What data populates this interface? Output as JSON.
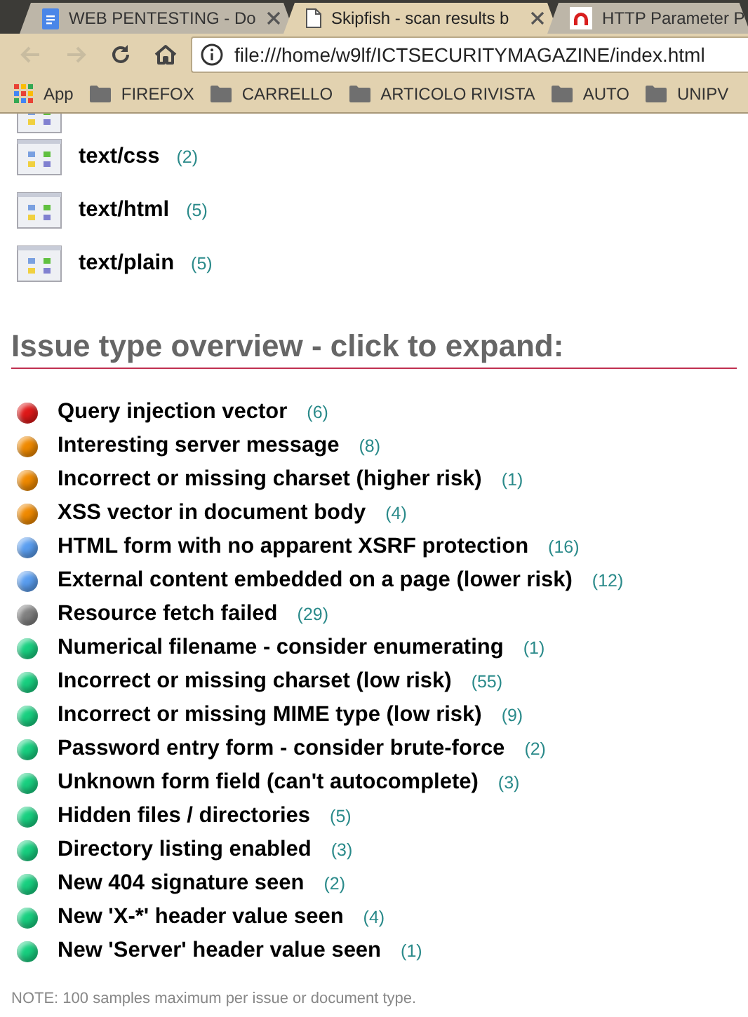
{
  "tabs": [
    {
      "title": "WEB PENTESTING - Do",
      "kind": "doc",
      "selected": false
    },
    {
      "title": "Skipfish - scan results b",
      "kind": "page",
      "selected": true
    },
    {
      "title": "HTTP Parameter P",
      "kind": "arc",
      "selected": false
    }
  ],
  "address_bar": {
    "url": "file:///home/w9lf/ICTSECURITYMAGAZINE/index.html"
  },
  "bookmarks": [
    {
      "label": "App",
      "kind": "apps"
    },
    {
      "label": "FIREFOX",
      "kind": "folder"
    },
    {
      "label": "CARRELLO",
      "kind": "folder"
    },
    {
      "label": "ARTICOLO RIVISTA",
      "kind": "folder"
    },
    {
      "label": "AUTO",
      "kind": "folder"
    },
    {
      "label": "UNIPV",
      "kind": "folder"
    }
  ],
  "document_types": [
    {
      "name": "text/css",
      "count": "(2)"
    },
    {
      "name": "text/html",
      "count": "(5)"
    },
    {
      "name": "text/plain",
      "count": "(5)"
    }
  ],
  "issue_overview": {
    "heading": "Issue type overview - click to expand:",
    "issues": [
      {
        "name": "Query injection vector",
        "count": "(6)",
        "color": "#e01818"
      },
      {
        "name": "Interesting server message",
        "count": "(8)",
        "color": "#f08a00"
      },
      {
        "name": "Incorrect or missing charset (higher risk)",
        "count": "(1)",
        "color": "#f08a00"
      },
      {
        "name": "XSS vector in document body",
        "count": "(4)",
        "color": "#f08a00"
      },
      {
        "name": "HTML form with no apparent XSRF protection",
        "count": "(16)",
        "color": "#5a9ef0"
      },
      {
        "name": "External content embedded on a page (lower risk)",
        "count": "(12)",
        "color": "#5a9ef0"
      },
      {
        "name": "Resource fetch failed",
        "count": "(29)",
        "color": "#808080"
      },
      {
        "name": "Numerical filename - consider enumerating",
        "count": "(1)",
        "color": "#18d080"
      },
      {
        "name": "Incorrect or missing charset (low risk)",
        "count": "(55)",
        "color": "#18d080"
      },
      {
        "name": "Incorrect or missing MIME type (low risk)",
        "count": "(9)",
        "color": "#18d080"
      },
      {
        "name": "Password entry form - consider brute-force",
        "count": "(2)",
        "color": "#18d080"
      },
      {
        "name": "Unknown form field (can't autocomplete)",
        "count": "(3)",
        "color": "#18d080"
      },
      {
        "name": "Hidden files / directories",
        "count": "(5)",
        "color": "#18d080"
      },
      {
        "name": "Directory listing enabled",
        "count": "(3)",
        "color": "#18d080"
      },
      {
        "name": "New 404 signature seen",
        "count": "(2)",
        "color": "#18d080"
      },
      {
        "name": "New 'X-*' header value seen",
        "count": "(4)",
        "color": "#18d080"
      },
      {
        "name": "New 'Server' header value seen",
        "count": "(1)",
        "color": "#18d080"
      }
    ]
  },
  "note": "NOTE: 100 samples maximum per issue or document type."
}
